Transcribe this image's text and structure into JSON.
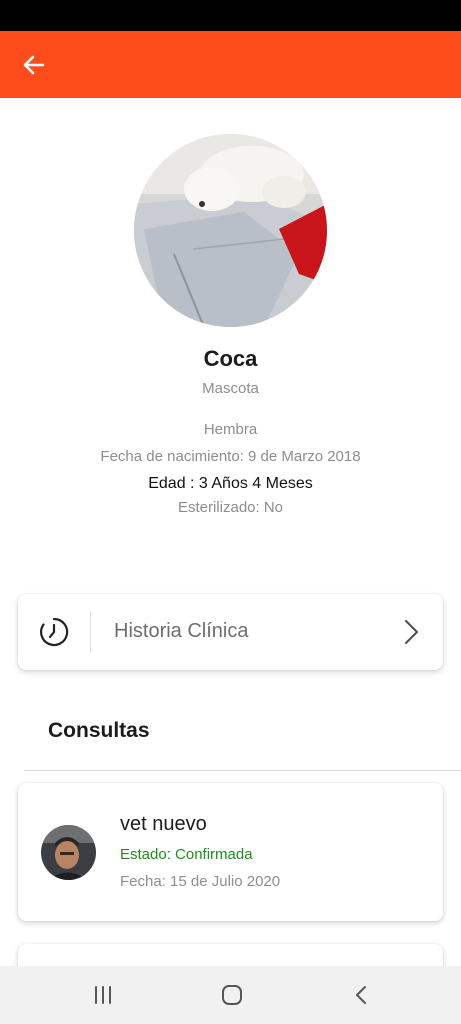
{
  "colors": {
    "app_bar": "#ff4c1a",
    "status_bar": "#000000",
    "confirmed": "#1e8e1e",
    "muted_text": "#8e8e8e"
  },
  "icons": {
    "back": "arrow-left-icon",
    "history": "clock-icon",
    "chevron": "chevron-right-icon",
    "nav_recents": "recents-icon",
    "nav_home": "home-icon",
    "nav_back": "back-icon"
  },
  "pet": {
    "name": "Coca",
    "type": "Mascota",
    "sex": "Hembra",
    "birth": "Fecha de nacimiento: 9 de Marzo 2018",
    "age": "Edad : 3 Años 4 Meses",
    "sterilized": "Esterilizado: No"
  },
  "history": {
    "label": "Historia Clínica"
  },
  "consultations": {
    "title": "Consultas",
    "items": [
      {
        "vet": "vet nuevo",
        "state": "Estado: Confirmada",
        "date": "Fecha: 15 de Julio 2020"
      }
    ]
  }
}
